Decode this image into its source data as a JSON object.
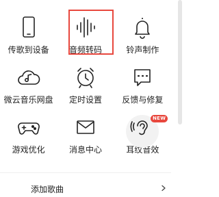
{
  "menu": {
    "items": [
      {
        "label": "传歌到设备",
        "icon": "phone-icon"
      },
      {
        "label": "音频转码",
        "icon": "waveform-icon",
        "highlighted": true
      },
      {
        "label": "铃声制作",
        "icon": "bell-icon"
      },
      {
        "label": "微云音乐网盘",
        "icon": "cloud-music-icon"
      },
      {
        "label": "定时设置",
        "icon": "alarm-clock-icon"
      },
      {
        "label": "反馈与修复",
        "icon": "feedback-icon"
      },
      {
        "label": "游戏优化",
        "icon": "gamepad-icon"
      },
      {
        "label": "消息中心",
        "icon": "envelope-icon"
      },
      {
        "label": "耳纹音效",
        "icon": "ear-icon",
        "badge": "NEW"
      }
    ],
    "add_song": {
      "label": "添加歌曲",
      "icon": "chevron-right-icon"
    }
  },
  "colors": {
    "highlight": "#e8473d",
    "badge": "#e8473d",
    "text": "#222222"
  }
}
